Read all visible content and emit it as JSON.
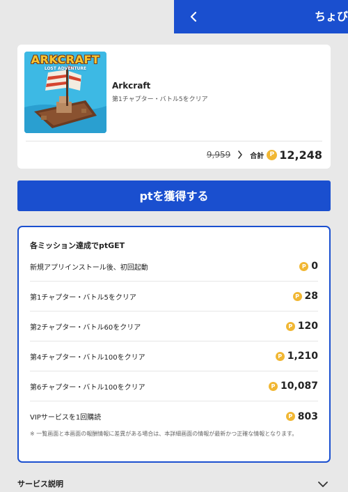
{
  "header": {
    "title": "ちょび"
  },
  "app": {
    "name": "Arkcraft",
    "mission": "第1チャプター・バトル5をクリア",
    "thumb_logo": "ARKCRAFT",
    "thumb_tagline": "LOST ADVENTURE",
    "old_price": "9,959",
    "total_label": "合計",
    "total_value": "12,248"
  },
  "cta": {
    "label": "ptを獲得する"
  },
  "missions": {
    "title": "各ミッション達成でptGET",
    "items": [
      {
        "label": "新規アプリインストール後、初回起動",
        "reward": "0"
      },
      {
        "label": "第1チャプター・バトル5をクリア",
        "reward": "28"
      },
      {
        "label": "第2チャプター・バトル60をクリア",
        "reward": "120"
      },
      {
        "label": "第4チャプター・バトル100をクリア",
        "reward": "1,210"
      },
      {
        "label": "第6チャプター・バトル100をクリア",
        "reward": "10,087"
      },
      {
        "label": "VIPサービスを1回購読",
        "reward": "803"
      }
    ],
    "note": "※ 一覧画面と本画面の報酬情報に差異がある場合は、本詳細画面の情報が最新かつ正確な情報となります。"
  },
  "service": {
    "label": "サービス説明"
  },
  "icons": {
    "coin": "P",
    "back": "chevron-left-icon",
    "arrow": "chevron-right-icon",
    "expand": "chevron-down-icon"
  },
  "colors": {
    "primary": "#1a4fcf",
    "background": "#e8e8e8",
    "coin": "#f1b733"
  }
}
